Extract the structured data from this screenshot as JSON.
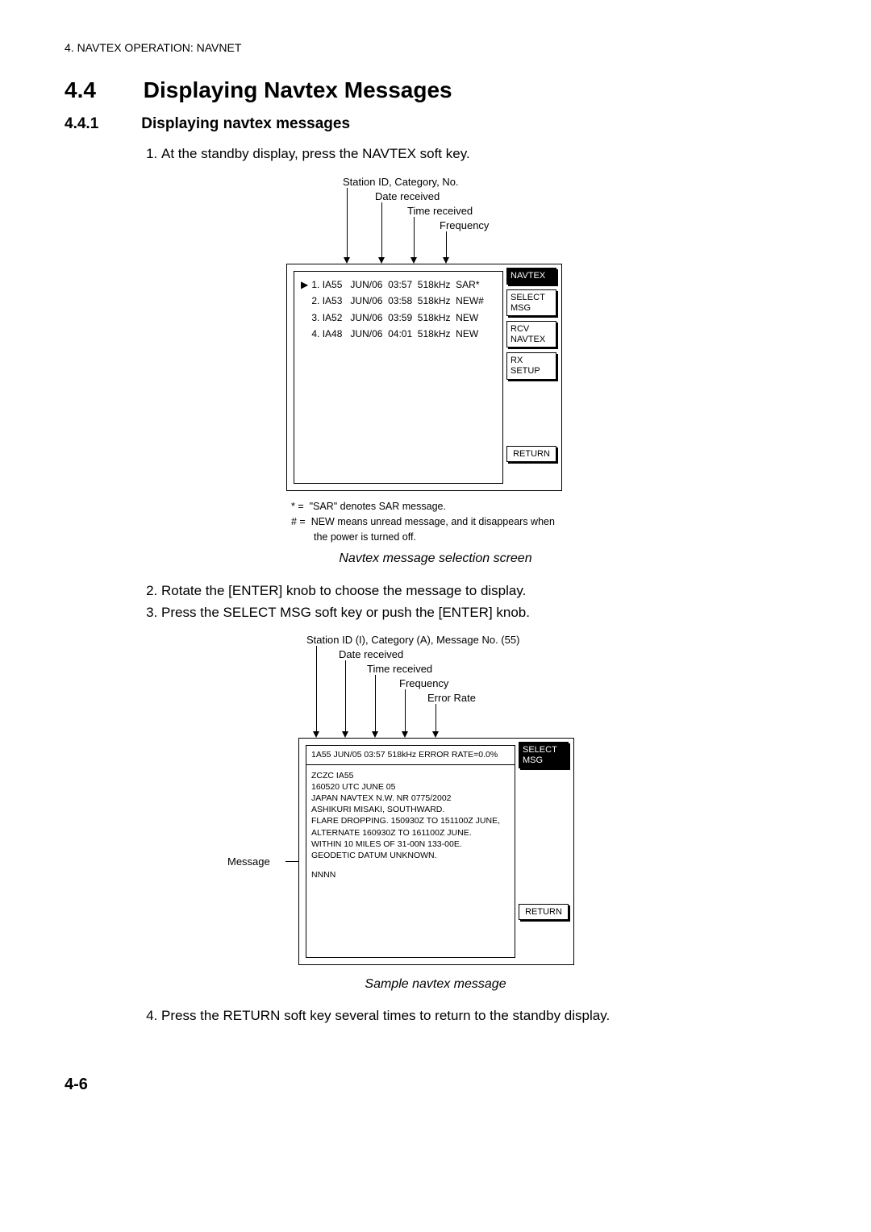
{
  "header": "4. NAVTEX OPERATION: NAVNET",
  "section": {
    "num": "4.4",
    "title": "Displaying Navtex Messages"
  },
  "subsection": {
    "num": "4.4.1",
    "title": "Displaying navtex messages"
  },
  "steps_a": [
    "At the standby display, press the NAVTEX soft key."
  ],
  "screen1": {
    "callouts": {
      "c1": "Station ID, Category, No.",
      "c2": "Date received",
      "c3": "Time received",
      "c4": "Frequency"
    },
    "rows": [
      {
        "no": "1.",
        "id": "IA55",
        "date": "JUN/06",
        "time": "03:57",
        "freq": "518kHz",
        "tag": "SAR*"
      },
      {
        "no": "2.",
        "id": "IA53",
        "date": "JUN/06",
        "time": "03:58",
        "freq": "518kHz",
        "tag": "NEW#"
      },
      {
        "no": "3.",
        "id": "IA52",
        "date": "JUN/06",
        "time": "03:59",
        "freq": "518kHz",
        "tag": "NEW"
      },
      {
        "no": "4.",
        "id": "IA48",
        "date": "JUN/06",
        "time": "04:01",
        "freq": "518kHz",
        "tag": "NEW"
      }
    ],
    "softkeys": {
      "title": "NAVTEX",
      "k1": "SELECT MSG",
      "k2": "RCV NAVTEX",
      "k3": "RX SETUP",
      "return": "RETURN"
    },
    "notes": {
      "n1_prefix": "* =",
      "n1": "\"SAR\" denotes SAR message.",
      "n2_prefix": "# =",
      "n2a": "NEW means unread message, and it disappears when",
      "n2b": "the power is turned off."
    },
    "caption": "Navtex message selection screen"
  },
  "steps_b": [
    "Rotate the [ENTER] knob to choose the message to display.",
    "Press the SELECT MSG soft key or push the [ENTER] knob."
  ],
  "screen2": {
    "callouts": {
      "c1": "Station ID (I), Category (A), Message No. (55)",
      "c2": "Date received",
      "c3": "Time received",
      "c4": "Frequency",
      "c5": "Error Rate",
      "message_label": "Message"
    },
    "header_line": "1A55  JUN/05  03:57  518kHz  ERROR RATE=0.0%",
    "body_lines": [
      "ZCZC  IA55",
      "160520 UTC JUNE 05",
      "JAPAN NAVTEX N.W. NR 0775/2002",
      "ASHIKURI MISAKI, SOUTHWARD.",
      "FLARE DROPPING.  150930Z TO 151100Z JUNE,",
      "ALTERNATE 160930Z TO 161100Z JUNE.",
      "WITHIN 10 MILES OF 31-00N 133-00E.",
      "GEODETIC DATUM UNKNOWN.",
      "",
      "NNNN"
    ],
    "softkeys": {
      "title": "SELECT MSG",
      "return": "RETURN"
    },
    "caption": "Sample navtex message"
  },
  "steps_c": [
    "Press the RETURN soft key several times to return to the standby display."
  ],
  "page_number": "4-6"
}
